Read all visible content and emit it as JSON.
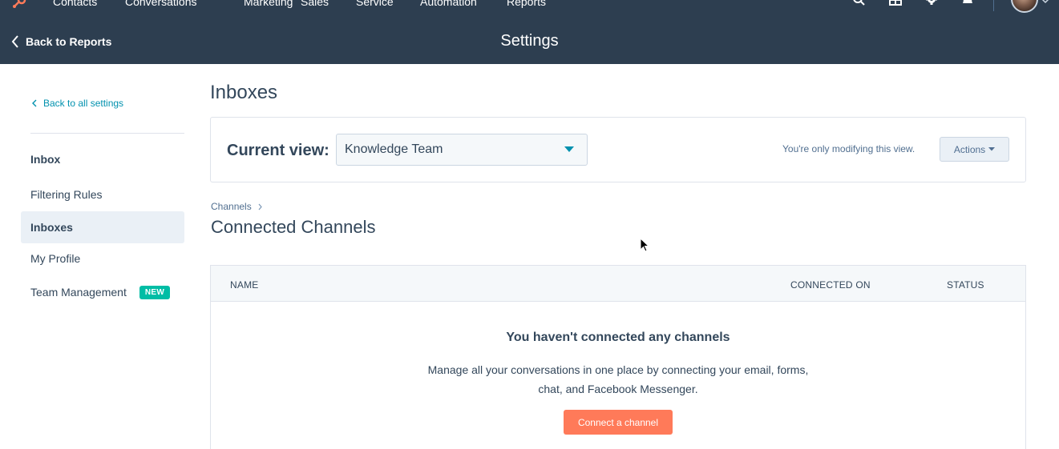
{
  "topnav": {
    "items": [
      "Contacts",
      "Conversations",
      "Marketing",
      "Sales",
      "Service",
      "Automation",
      "Reports"
    ]
  },
  "header": {
    "back_label": "Back to Reports",
    "title": "Settings"
  },
  "sidebar": {
    "back_all_label": "Back to all settings",
    "section_heading": "Inbox",
    "items": [
      {
        "label": "Filtering Rules"
      },
      {
        "label": "Inboxes"
      },
      {
        "label": "My Profile"
      },
      {
        "label": "Team Management",
        "badge": "NEW"
      }
    ],
    "active_item": "Inboxes"
  },
  "main": {
    "title": "Inboxes",
    "current_view_label": "Current view:",
    "current_view_value": "Knowledge Team",
    "view_note": "You're only modifying this view.",
    "actions_label": "Actions",
    "breadcrumb": "Channels",
    "section_title": "Connected Channels",
    "table": {
      "columns": [
        "NAME",
        "CONNECTED ON",
        "STATUS"
      ],
      "empty_title": "You haven't connected any channels",
      "empty_description": "Manage all your conversations in one place by connecting your email, forms, chat, and Facebook Messenger.",
      "cta_label": "Connect a channel"
    }
  },
  "colors": {
    "nav_bg": "#2d3e50",
    "accent_link": "#0091ae",
    "cta": "#ff7a59",
    "badge": "#00bda5",
    "active_bg": "#eaf0f6"
  }
}
